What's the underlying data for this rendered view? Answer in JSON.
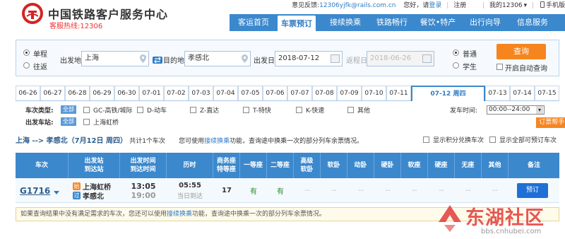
{
  "header": {
    "logo_title": "中国铁路客户服务中心",
    "hotline": "客服热线:12306",
    "topbar": {
      "feedback_label": "意见反馈:",
      "feedback_email": "12306yjfk@rails.com.cn",
      "greeting": "您好，请",
      "login": "登录",
      "separator1": "|",
      "register": "注册",
      "separator2": "|",
      "my12306": "我的12306",
      "dropdown": "▾",
      "separator3": "|",
      "mobile": "手机版"
    },
    "nav": [
      {
        "label": "客运首页",
        "active": false
      },
      {
        "label": "车票预订",
        "active": true
      },
      {
        "label": "接续换乘",
        "active": false
      },
      {
        "label": "铁路畅行",
        "active": false
      },
      {
        "label": "餐饮•特产",
        "active": false
      },
      {
        "label": "出行向导",
        "active": false
      },
      {
        "label": "信息服务",
        "active": false
      }
    ]
  },
  "search": {
    "trip_single": "单程",
    "trip_round": "往返",
    "from_label": "出发地",
    "from_value": "上海",
    "to_label": "目的地",
    "to_value": "孝感北",
    "depart_label": "出发日",
    "depart_value": "2018-07-12",
    "return_label": "返程日",
    "return_value": "2018-06-26",
    "type_normal": "普通",
    "type_student": "学生",
    "query_button": "查询",
    "auto_query": "开启自动查询"
  },
  "date_tabs": [
    "06-26",
    "06-27",
    "06-28",
    "06-29",
    "06-30",
    "07-01",
    "07-02",
    "07-03",
    "07-04",
    "07-05",
    "07-06",
    "07-07",
    "07-08",
    "07-09",
    "07-10",
    "07-11",
    "07-12 周四",
    "07-13",
    "07-14",
    "07-15"
  ],
  "active_date_index": 16,
  "filters": {
    "train_type_label": "车次类型:",
    "all_tag": "全部",
    "types": [
      "GC-高铁/城际",
      "D-动车",
      "Z-直达",
      "T-特快",
      "K-快速",
      "其他"
    ],
    "station_label": "出发车站:",
    "station_all_tag": "全部",
    "station": "上海虹桥",
    "depart_time_label": "发车时间:",
    "depart_time_value": "00:00--24:00",
    "help_button": "订票帮手 ▾"
  },
  "summary": {
    "route": "上海 --> 孝感北（7月12日 周四）",
    "count": "共计1个车次",
    "tip_prefix": "您可使用",
    "tip_link": "接续换乘",
    "tip_suffix": "功能，查询途中换乘一次的部分列车余票情况。",
    "opt_points": "显示积分兑换车次",
    "opt_all": "显示全部可预订车次"
  },
  "table": {
    "headers": [
      "车次",
      "出发站\n到达站",
      "出发时间\n到达时间",
      "历时",
      "商务座\n特等座",
      "一等座",
      "二等座",
      "高级\n软卧",
      "软卧",
      "动卧",
      "硬卧",
      "软座",
      "硬座",
      "无座",
      "其他",
      "备注"
    ],
    "row": {
      "train_no": "G1716",
      "from_tag": "始",
      "to_tag": "过",
      "from_station": "上海虹桥",
      "to_station": "孝感北",
      "depart_time": "13:05",
      "arrive_time": "19:00",
      "duration": "05:55",
      "arrive_day": "当日到达",
      "business": "17",
      "first": "有",
      "second": "有",
      "dash": "--",
      "book_button": "预订"
    }
  },
  "note": {
    "prefix": "如果查询结果中没有满足需求的车次，您还可以使用",
    "link": "接续换乘",
    "suffix": "功能，查询途中换乘一次的部分列车余票情况。"
  },
  "watermark": {
    "text": "东湖社区",
    "url": "bbs.cnhubei.com"
  },
  "colors": {
    "brand_blue": "#3b88cd",
    "accent_orange": "#f7851e",
    "available_green": "#2e8b2e",
    "logo_red": "#d42323"
  }
}
